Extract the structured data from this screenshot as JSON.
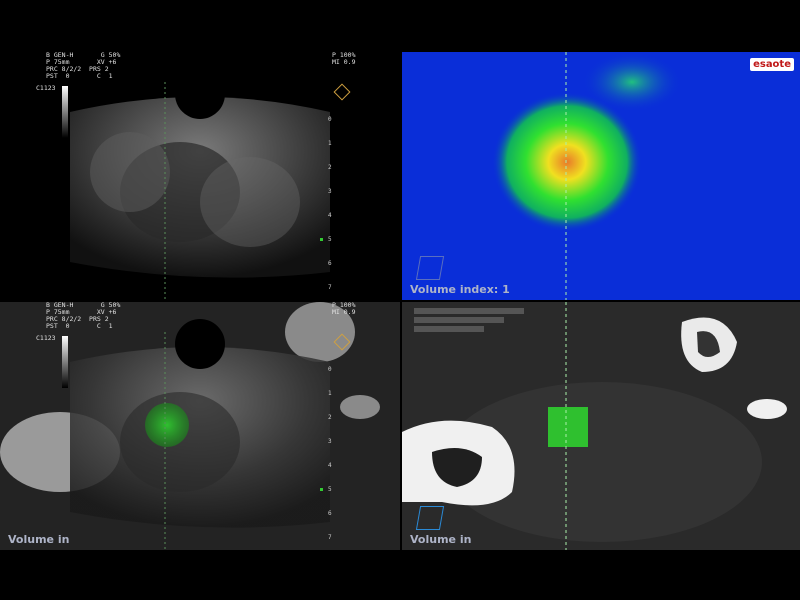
{
  "panels": {
    "top_left": {
      "params_left": "B GEN-H       G 50%\nP 75mm       XV +6\nPRC 8/2/2  PRS 2\nPST  0       C  1",
      "params_right": "P 100%\nMI 0.9",
      "probe": "C1123",
      "depth_marks": [
        "0",
        "1",
        "2",
        "3",
        "4",
        "5",
        "6",
        "7"
      ]
    },
    "top_right": {
      "brand": "esaote",
      "volume_label": "Volume index: 1"
    },
    "bottom_left": {
      "params_left": "B GEN-H       G 50%\nP 75mm       XV +6\nPRC 8/2/2  PRS 2\nPST  0       C  1",
      "params_right": "P 100%\nMI 0.9",
      "probe": "C1123",
      "depth_marks": [
        "0",
        "1",
        "2",
        "3",
        "4",
        "5",
        "6",
        "7"
      ],
      "volume_label": "Volume in"
    },
    "bottom_right": {
      "volume_label": "Volume in"
    }
  },
  "colors": {
    "background": "#000000",
    "heatmap_bg": "#0a2ed8",
    "overlay_green": "#2fcf2f",
    "brand_red": "#c01818"
  },
  "icons": [
    "grayscale-bar-icon",
    "orientation-icon",
    "volume-cube-icon",
    "esaote-logo-icon"
  ]
}
